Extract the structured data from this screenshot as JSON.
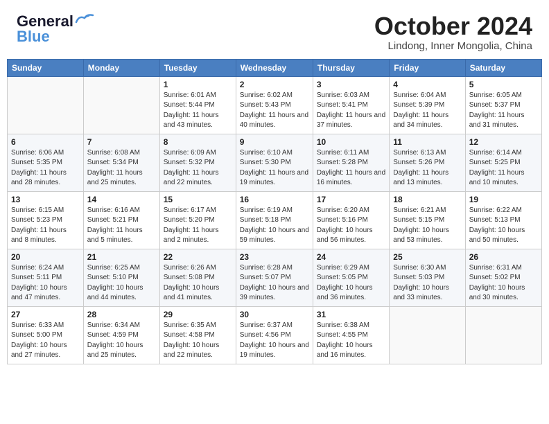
{
  "header": {
    "logo_general": "General",
    "logo_blue": "Blue",
    "month_title": "October 2024",
    "location": "Lindong, Inner Mongolia, China"
  },
  "weekdays": [
    "Sunday",
    "Monday",
    "Tuesday",
    "Wednesday",
    "Thursday",
    "Friday",
    "Saturday"
  ],
  "weeks": [
    [
      {
        "day": "",
        "info": ""
      },
      {
        "day": "",
        "info": ""
      },
      {
        "day": "1",
        "info": "Sunrise: 6:01 AM\nSunset: 5:44 PM\nDaylight: 11 hours and 43 minutes."
      },
      {
        "day": "2",
        "info": "Sunrise: 6:02 AM\nSunset: 5:43 PM\nDaylight: 11 hours and 40 minutes."
      },
      {
        "day": "3",
        "info": "Sunrise: 6:03 AM\nSunset: 5:41 PM\nDaylight: 11 hours and 37 minutes."
      },
      {
        "day": "4",
        "info": "Sunrise: 6:04 AM\nSunset: 5:39 PM\nDaylight: 11 hours and 34 minutes."
      },
      {
        "day": "5",
        "info": "Sunrise: 6:05 AM\nSunset: 5:37 PM\nDaylight: 11 hours and 31 minutes."
      }
    ],
    [
      {
        "day": "6",
        "info": "Sunrise: 6:06 AM\nSunset: 5:35 PM\nDaylight: 11 hours and 28 minutes."
      },
      {
        "day": "7",
        "info": "Sunrise: 6:08 AM\nSunset: 5:34 PM\nDaylight: 11 hours and 25 minutes."
      },
      {
        "day": "8",
        "info": "Sunrise: 6:09 AM\nSunset: 5:32 PM\nDaylight: 11 hours and 22 minutes."
      },
      {
        "day": "9",
        "info": "Sunrise: 6:10 AM\nSunset: 5:30 PM\nDaylight: 11 hours and 19 minutes."
      },
      {
        "day": "10",
        "info": "Sunrise: 6:11 AM\nSunset: 5:28 PM\nDaylight: 11 hours and 16 minutes."
      },
      {
        "day": "11",
        "info": "Sunrise: 6:13 AM\nSunset: 5:26 PM\nDaylight: 11 hours and 13 minutes."
      },
      {
        "day": "12",
        "info": "Sunrise: 6:14 AM\nSunset: 5:25 PM\nDaylight: 11 hours and 10 minutes."
      }
    ],
    [
      {
        "day": "13",
        "info": "Sunrise: 6:15 AM\nSunset: 5:23 PM\nDaylight: 11 hours and 8 minutes."
      },
      {
        "day": "14",
        "info": "Sunrise: 6:16 AM\nSunset: 5:21 PM\nDaylight: 11 hours and 5 minutes."
      },
      {
        "day": "15",
        "info": "Sunrise: 6:17 AM\nSunset: 5:20 PM\nDaylight: 11 hours and 2 minutes."
      },
      {
        "day": "16",
        "info": "Sunrise: 6:19 AM\nSunset: 5:18 PM\nDaylight: 10 hours and 59 minutes."
      },
      {
        "day": "17",
        "info": "Sunrise: 6:20 AM\nSunset: 5:16 PM\nDaylight: 10 hours and 56 minutes."
      },
      {
        "day": "18",
        "info": "Sunrise: 6:21 AM\nSunset: 5:15 PM\nDaylight: 10 hours and 53 minutes."
      },
      {
        "day": "19",
        "info": "Sunrise: 6:22 AM\nSunset: 5:13 PM\nDaylight: 10 hours and 50 minutes."
      }
    ],
    [
      {
        "day": "20",
        "info": "Sunrise: 6:24 AM\nSunset: 5:11 PM\nDaylight: 10 hours and 47 minutes."
      },
      {
        "day": "21",
        "info": "Sunrise: 6:25 AM\nSunset: 5:10 PM\nDaylight: 10 hours and 44 minutes."
      },
      {
        "day": "22",
        "info": "Sunrise: 6:26 AM\nSunset: 5:08 PM\nDaylight: 10 hours and 41 minutes."
      },
      {
        "day": "23",
        "info": "Sunrise: 6:28 AM\nSunset: 5:07 PM\nDaylight: 10 hours and 39 minutes."
      },
      {
        "day": "24",
        "info": "Sunrise: 6:29 AM\nSunset: 5:05 PM\nDaylight: 10 hours and 36 minutes."
      },
      {
        "day": "25",
        "info": "Sunrise: 6:30 AM\nSunset: 5:03 PM\nDaylight: 10 hours and 33 minutes."
      },
      {
        "day": "26",
        "info": "Sunrise: 6:31 AM\nSunset: 5:02 PM\nDaylight: 10 hours and 30 minutes."
      }
    ],
    [
      {
        "day": "27",
        "info": "Sunrise: 6:33 AM\nSunset: 5:00 PM\nDaylight: 10 hours and 27 minutes."
      },
      {
        "day": "28",
        "info": "Sunrise: 6:34 AM\nSunset: 4:59 PM\nDaylight: 10 hours and 25 minutes."
      },
      {
        "day": "29",
        "info": "Sunrise: 6:35 AM\nSunset: 4:58 PM\nDaylight: 10 hours and 22 minutes."
      },
      {
        "day": "30",
        "info": "Sunrise: 6:37 AM\nSunset: 4:56 PM\nDaylight: 10 hours and 19 minutes."
      },
      {
        "day": "31",
        "info": "Sunrise: 6:38 AM\nSunset: 4:55 PM\nDaylight: 10 hours and 16 minutes."
      },
      {
        "day": "",
        "info": ""
      },
      {
        "day": "",
        "info": ""
      }
    ]
  ]
}
